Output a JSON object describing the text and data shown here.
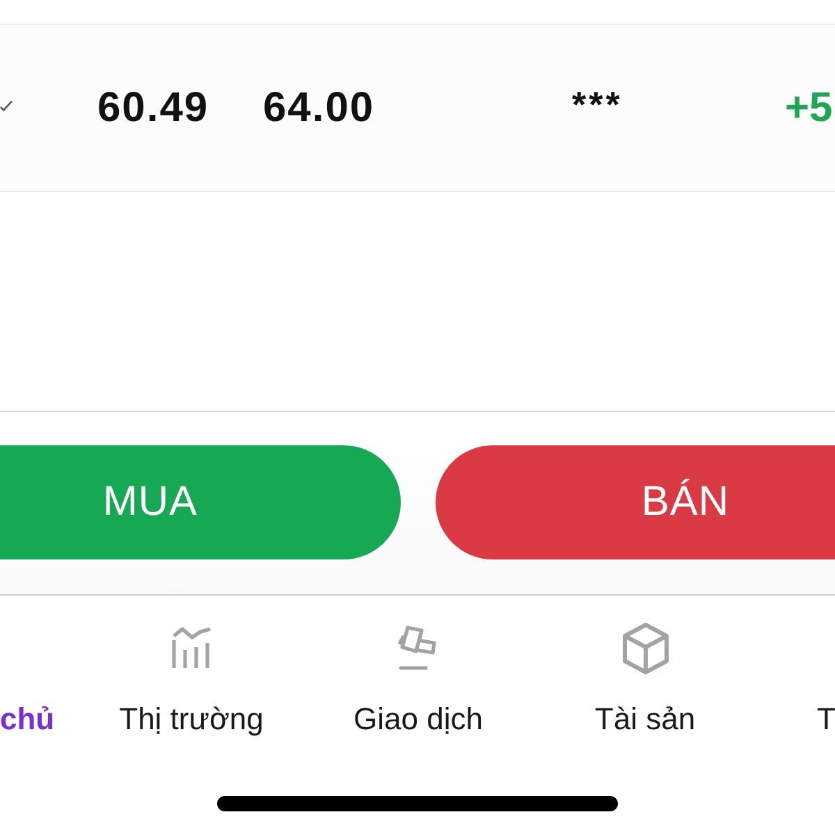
{
  "quote_row": {
    "values": [
      {
        "kind": "price",
        "text": "60.49"
      },
      {
        "kind": "price",
        "text": "64.00"
      },
      {
        "kind": "masked",
        "text": "***"
      },
      {
        "kind": "change",
        "text": "+5"
      }
    ]
  },
  "trade_buttons": [
    {
      "kind": "buy",
      "label": "MUA"
    },
    {
      "kind": "sell",
      "label": "BÁN"
    }
  ],
  "bottom_nav": [
    {
      "label": "chủ",
      "selected": true
    },
    {
      "label": "Thị trường",
      "selected": false,
      "kind": "market"
    },
    {
      "label": "Giao dịch",
      "selected": false,
      "kind": "trade"
    },
    {
      "label": "Tài sản",
      "selected": false,
      "kind": "assets"
    },
    {
      "label": "T",
      "selected": false
    }
  ]
}
